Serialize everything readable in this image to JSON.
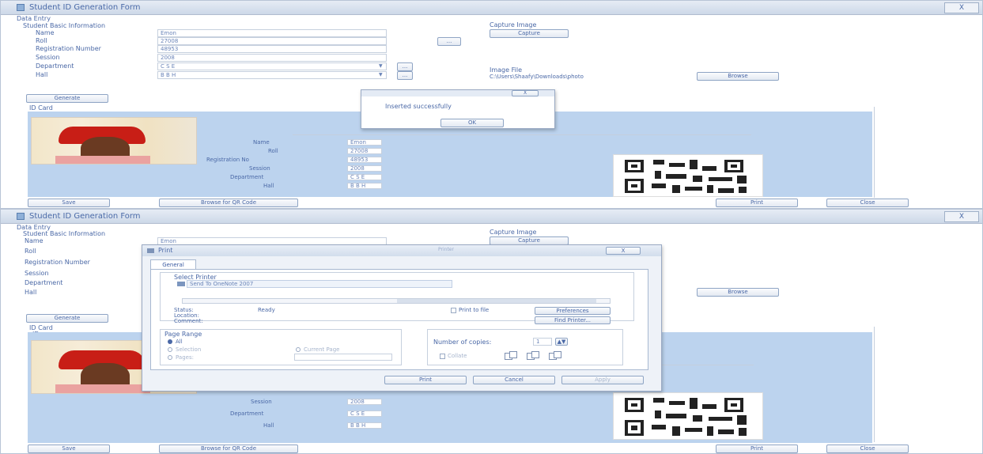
{
  "window_title": "Student ID Generation Form",
  "close_label": "X",
  "data_entry": {
    "group": "Data Entry",
    "basic_info": "Student Basic Information",
    "name_label": "Name",
    "roll_label": "Roll",
    "reg_label": "Registration Number",
    "session_label": "Session",
    "dept_label": "Department",
    "hall_label": "Hall",
    "name": "Emon",
    "roll": "27008",
    "reg": "48953",
    "session": "2008",
    "dept": "C S E",
    "hall": "B B H",
    "small_btn": "...",
    "side_btn": "..."
  },
  "capture": {
    "label": "Capture Image",
    "button": "Capture"
  },
  "image_file": {
    "label": "Image File",
    "path": "C:\\Users\\Shaafy\\Downloads\\photo",
    "browse": "Browse"
  },
  "generate_button": "Generate",
  "id_card": {
    "group": "ID Card",
    "sub": "ID",
    "fields": [
      {
        "label": "Name",
        "value": "Emon"
      },
      {
        "label": "Roll",
        "value": "27008"
      },
      {
        "label": "Registration No",
        "value": "48953"
      },
      {
        "label": "Session",
        "value": "2008"
      },
      {
        "label": "Department",
        "value": "C S E"
      },
      {
        "label": "Hall",
        "value": "B B H"
      }
    ]
  },
  "bottom": {
    "save": "Save",
    "browse_qr": "Browse for QR Code",
    "print": "Print",
    "close": "Close"
  },
  "msgbox": {
    "message": "Inserted successfully",
    "ok": "OK",
    "close": "X"
  },
  "print_dialog": {
    "title": "Print",
    "title_hint": "Printer",
    "close": "X",
    "tab": "General",
    "select_printer": "Select Printer",
    "printer": "Send To OneNote 2007",
    "status_label": "Status:",
    "status_value": "Ready",
    "location_label": "Location:",
    "comment_label": "Comment:",
    "print_to_file": "Print to file",
    "preferences": "Preferences",
    "find_printer": "Find Printer...",
    "page_range": "Page Range",
    "all": "All",
    "selection": "Selection",
    "current_page": "Current Page",
    "pages": "Pages:",
    "copies_label": "Number of copies:",
    "copies": "1",
    "collate": "Collate",
    "print_btn": "Print",
    "cancel_btn": "Cancel",
    "apply_btn": "Apply"
  }
}
